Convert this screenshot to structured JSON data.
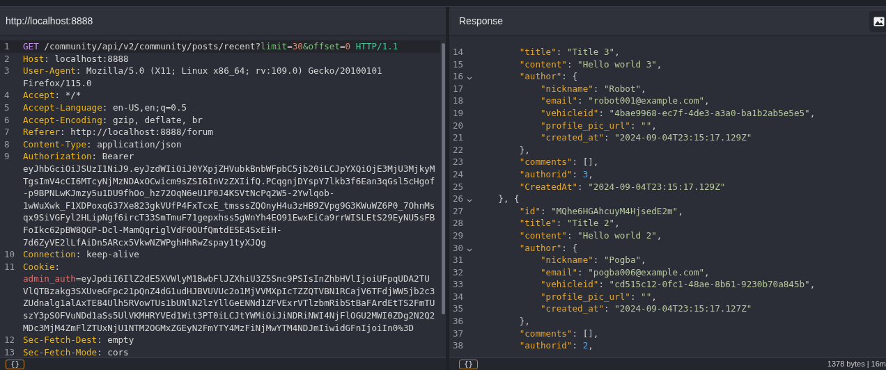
{
  "request": {
    "url": "http://localhost:8888",
    "format_button": "{}",
    "lines": [
      {
        "num": "1",
        "current": true,
        "tokens": [
          {
            "kind": "method",
            "text": "GET"
          },
          {
            "kind": "path",
            "text": " /community/api/v2/community/posts/recent?"
          },
          {
            "kind": "param",
            "text": "limit"
          },
          {
            "kind": "eq",
            "text": "="
          },
          {
            "kind": "num",
            "text": "30"
          },
          {
            "kind": "param",
            "text": "&"
          },
          {
            "kind": "param",
            "text": "offset"
          },
          {
            "kind": "eq",
            "text": "="
          },
          {
            "kind": "num",
            "text": "0"
          },
          {
            "kind": "version",
            "text": " HTTP/1.1"
          }
        ]
      },
      {
        "num": "2",
        "current": false,
        "tokens": [
          {
            "kind": "header",
            "text": "Host"
          },
          {
            "kind": "value",
            "text": ": localhost:8888"
          }
        ]
      },
      {
        "num": "3",
        "current": false,
        "tokens": [
          {
            "kind": "header",
            "text": "User-Agent"
          },
          {
            "kind": "value",
            "text": ": Mozilla/5.0 (X11; Linux x86_64; rv:109.0) Gecko/20100101 Firefox/115.0"
          }
        ]
      },
      {
        "num": "4",
        "current": false,
        "tokens": [
          {
            "kind": "header",
            "text": "Accept"
          },
          {
            "kind": "value",
            "text": ": */*"
          }
        ]
      },
      {
        "num": "5",
        "current": false,
        "tokens": [
          {
            "kind": "header",
            "text": "Accept-Language"
          },
          {
            "kind": "value",
            "text": ": en-US,en;q=0.5"
          }
        ]
      },
      {
        "num": "6",
        "current": false,
        "tokens": [
          {
            "kind": "header",
            "text": "Accept-Encoding"
          },
          {
            "kind": "value",
            "text": ": gzip, deflate, br"
          }
        ]
      },
      {
        "num": "7",
        "current": false,
        "tokens": [
          {
            "kind": "header",
            "text": "Referer"
          },
          {
            "kind": "value",
            "text": ": http://localhost:8888/forum"
          }
        ]
      },
      {
        "num": "8",
        "current": false,
        "tokens": [
          {
            "kind": "header",
            "text": "Content-Type"
          },
          {
            "kind": "value",
            "text": ": application/json"
          }
        ]
      },
      {
        "num": "9",
        "current": false,
        "tokens": [
          {
            "kind": "header",
            "text": "Authorization"
          },
          {
            "kind": "value",
            "text": ": Bearer eyJhbGciOiJSUzI1NiJ9.eyJzdWIiOiJ0YXpjZHVubkBnbWFpbC5jb20iLCJpYXQiOjE3MjU3MjkyMTgsImV4cCI6MTcyNjMzNDAxOCwicm9sZSI6InVzZXIifQ.PCqgnjDYspY7lkb3f6Ean3qGsl5cHgof-p9BPNLwKJmzy5u1DU9fhOo_hz72OqN6eU1P0J4KSVtNcPq2W5-2Ywlqob-1wWuXwk_F1XDPoxqG37Xe823gkVUfP4FxTcxE_tmsssZQOnyH4u3zHB9ZVpg9G3KWuWZ6P0_7OhnMsqx9SiVGFyl2HLipNgf6ircT33SmTmuF71gepxhss5gWnYh4EO91EwxEiCa9rrWISLEtS29EyNU5sFBFoIkc62pBW8QGP-Dcl-MamQqriglVdF0OUfQmtdESE4SxEiH-7d6ZyVE2lLfAiDn5ARcx5VkwNZWPghHhRwZspay1tyXJQg"
          }
        ]
      },
      {
        "num": "10",
        "current": false,
        "tokens": [
          {
            "kind": "header",
            "text": "Connection"
          },
          {
            "kind": "value",
            "text": ": keep-alive"
          }
        ]
      },
      {
        "num": "11",
        "current": false,
        "tokens": [
          {
            "kind": "header",
            "text": "Cookie"
          },
          {
            "kind": "value",
            "text": ": "
          },
          {
            "kind": "cookie",
            "text": "admin_auth"
          },
          {
            "kind": "eq",
            "text": "="
          },
          {
            "kind": "value",
            "text": "eyJpdiI6IlZ2dE5XVWlyM1BwbFlJZXhiU3Z5Snc9PSIsInZhbHVlIjoiUFpqUDA2TUVlQTBzakg3SXUveGFpc21pQnZ4dG1udHJBVUVUc2o1MjVVMXpIcTZZQTVBN1RCajV6TFdjWW5jb2c3ZUdnalg1alAxTE84Ulh5RVowTUs1bUNlN2lzYllGeENNd1ZFVExrVTlzbmRibStBaFArdEtTS2FmTUszY3pSOFVuNDd1aSs5UlVKMHRYVEd1Wit3PT0iLCJtYWMiOiJiNDRiNWI4NjFlOGU2MWI0ZDg2N2Q2MDc3MjM4ZmFlZTUxNjU1NTM2OGMxZGEyN2FmYTY4MzFiNjMwYTM4NDJmIiwidGFnIjoiIn0%3D"
          }
        ]
      },
      {
        "num": "12",
        "current": false,
        "tokens": [
          {
            "kind": "header",
            "text": "Sec-Fetch-Dest"
          },
          {
            "kind": "value",
            "text": ": empty"
          }
        ]
      },
      {
        "num": "13",
        "current": false,
        "tokens": [
          {
            "kind": "header",
            "text": "Sec-Fetch-Mode"
          },
          {
            "kind": "value",
            "text": ": cors"
          }
        ]
      }
    ]
  },
  "response": {
    "title": "Response",
    "format_button": "{}",
    "status": "1378 bytes | 16m",
    "lines": [
      {
        "num": "14",
        "fold": false,
        "tokens": [
          {
            "kind": "key",
            "text": "        \"title\""
          },
          {
            "kind": "punct",
            "text": ": "
          },
          {
            "kind": "str",
            "text": "\"Title 3\""
          },
          {
            "kind": "punct",
            "text": ","
          }
        ]
      },
      {
        "num": "15",
        "fold": false,
        "tokens": [
          {
            "kind": "key",
            "text": "        \"content\""
          },
          {
            "kind": "punct",
            "text": ": "
          },
          {
            "kind": "str",
            "text": "\"Hello world 3\""
          },
          {
            "kind": "punct",
            "text": ","
          }
        ]
      },
      {
        "num": "16",
        "fold": true,
        "tokens": [
          {
            "kind": "key",
            "text": "        \"author\""
          },
          {
            "kind": "punct",
            "text": ": {"
          }
        ]
      },
      {
        "num": "17",
        "fold": false,
        "tokens": [
          {
            "kind": "key",
            "text": "            \"nickname\""
          },
          {
            "kind": "punct",
            "text": ": "
          },
          {
            "kind": "str",
            "text": "\"Robot\""
          },
          {
            "kind": "punct",
            "text": ","
          }
        ]
      },
      {
        "num": "18",
        "fold": false,
        "tokens": [
          {
            "kind": "key",
            "text": "            \"email\""
          },
          {
            "kind": "punct",
            "text": ": "
          },
          {
            "kind": "str",
            "text": "\"robot001@example.com\""
          },
          {
            "kind": "punct",
            "text": ","
          }
        ]
      },
      {
        "num": "19",
        "fold": false,
        "tokens": [
          {
            "kind": "key",
            "text": "            \"vehicleid\""
          },
          {
            "kind": "punct",
            "text": ": "
          },
          {
            "kind": "str",
            "text": "\"4bae9968-ec7f-4de3-a3a0-ba1b2ab5e5e5\""
          },
          {
            "kind": "punct",
            "text": ","
          }
        ]
      },
      {
        "num": "20",
        "fold": false,
        "tokens": [
          {
            "kind": "key",
            "text": "            \"profile_pic_url\""
          },
          {
            "kind": "punct",
            "text": ": "
          },
          {
            "kind": "str",
            "text": "\"\""
          },
          {
            "kind": "punct",
            "text": ","
          }
        ]
      },
      {
        "num": "21",
        "fold": false,
        "tokens": [
          {
            "kind": "key",
            "text": "            \"created_at\""
          },
          {
            "kind": "punct",
            "text": ": "
          },
          {
            "kind": "str",
            "text": "\"2024-09-04T23:15:17.129Z\""
          }
        ]
      },
      {
        "num": "22",
        "fold": false,
        "tokens": [
          {
            "kind": "punct",
            "text": "        },"
          }
        ]
      },
      {
        "num": "23",
        "fold": false,
        "tokens": [
          {
            "kind": "key",
            "text": "        \"comments\""
          },
          {
            "kind": "punct",
            "text": ": [],"
          }
        ]
      },
      {
        "num": "24",
        "fold": false,
        "tokens": [
          {
            "kind": "key",
            "text": "        \"authorid\""
          },
          {
            "kind": "punct",
            "text": ": "
          },
          {
            "kind": "num",
            "text": "3"
          },
          {
            "kind": "punct",
            "text": ","
          }
        ]
      },
      {
        "num": "25",
        "fold": false,
        "tokens": [
          {
            "kind": "key",
            "text": "        \"CreatedAt\""
          },
          {
            "kind": "punct",
            "text": ": "
          },
          {
            "kind": "str",
            "text": "\"2024-09-04T23:15:17.129Z\""
          }
        ]
      },
      {
        "num": "26",
        "fold": true,
        "tokens": [
          {
            "kind": "punct",
            "text": "    }, {"
          }
        ]
      },
      {
        "num": "27",
        "fold": false,
        "tokens": [
          {
            "kind": "key",
            "text": "        \"id\""
          },
          {
            "kind": "punct",
            "text": ": "
          },
          {
            "kind": "str",
            "text": "\"MQhe6HGAhcuyM4HjsedE2m\""
          },
          {
            "kind": "punct",
            "text": ","
          }
        ]
      },
      {
        "num": "28",
        "fold": false,
        "tokens": [
          {
            "kind": "key",
            "text": "        \"title\""
          },
          {
            "kind": "punct",
            "text": ": "
          },
          {
            "kind": "str",
            "text": "\"Title 2\""
          },
          {
            "kind": "punct",
            "text": ","
          }
        ]
      },
      {
        "num": "29",
        "fold": false,
        "tokens": [
          {
            "kind": "key",
            "text": "        \"content\""
          },
          {
            "kind": "punct",
            "text": ": "
          },
          {
            "kind": "str",
            "text": "\"Hello world 2\""
          },
          {
            "kind": "punct",
            "text": ","
          }
        ]
      },
      {
        "num": "30",
        "fold": true,
        "tokens": [
          {
            "kind": "key",
            "text": "        \"author\""
          },
          {
            "kind": "punct",
            "text": ": {"
          }
        ]
      },
      {
        "num": "31",
        "fold": false,
        "tokens": [
          {
            "kind": "key",
            "text": "            \"nickname\""
          },
          {
            "kind": "punct",
            "text": ": "
          },
          {
            "kind": "str",
            "text": "\"Pogba\""
          },
          {
            "kind": "punct",
            "text": ","
          }
        ]
      },
      {
        "num": "32",
        "fold": false,
        "tokens": [
          {
            "kind": "key",
            "text": "            \"email\""
          },
          {
            "kind": "punct",
            "text": ": "
          },
          {
            "kind": "str",
            "text": "\"pogba006@example.com\""
          },
          {
            "kind": "punct",
            "text": ","
          }
        ]
      },
      {
        "num": "33",
        "fold": false,
        "tokens": [
          {
            "kind": "key",
            "text": "            \"vehicleid\""
          },
          {
            "kind": "punct",
            "text": ": "
          },
          {
            "kind": "str",
            "text": "\"cd515c12-0fc1-48ae-8b61-9230b70a845b\""
          },
          {
            "kind": "punct",
            "text": ","
          }
        ]
      },
      {
        "num": "34",
        "fold": false,
        "tokens": [
          {
            "kind": "key",
            "text": "            \"profile_pic_url\""
          },
          {
            "kind": "punct",
            "text": ": "
          },
          {
            "kind": "str",
            "text": "\"\""
          },
          {
            "kind": "punct",
            "text": ","
          }
        ]
      },
      {
        "num": "35",
        "fold": false,
        "tokens": [
          {
            "kind": "key",
            "text": "            \"created_at\""
          },
          {
            "kind": "punct",
            "text": ": "
          },
          {
            "kind": "str",
            "text": "\"2024-09-04T23:15:17.127Z\""
          }
        ]
      },
      {
        "num": "36",
        "fold": false,
        "tokens": [
          {
            "kind": "punct",
            "text": "        },"
          }
        ]
      },
      {
        "num": "37",
        "fold": false,
        "tokens": [
          {
            "kind": "key",
            "text": "        \"comments\""
          },
          {
            "kind": "punct",
            "text": ": [],"
          }
        ]
      },
      {
        "num": "38",
        "fold": false,
        "tokens": [
          {
            "kind": "key",
            "text": "        \"authorid\""
          },
          {
            "kind": "punct",
            "text": ": "
          },
          {
            "kind": "num",
            "text": "2"
          },
          {
            "kind": "punct",
            "text": ","
          }
        ]
      }
    ]
  }
}
